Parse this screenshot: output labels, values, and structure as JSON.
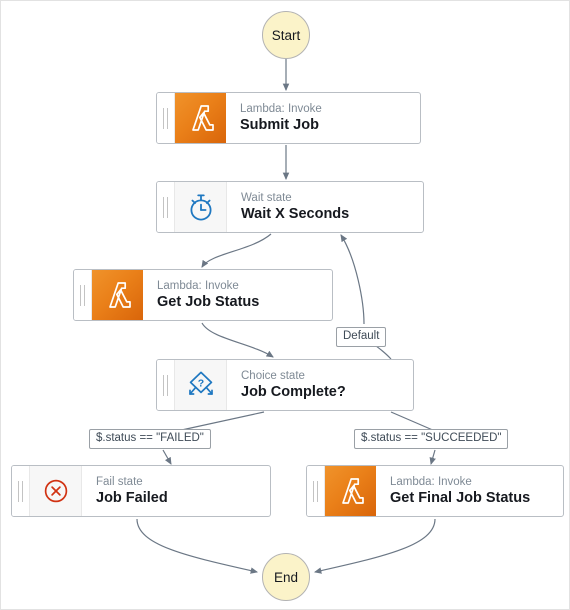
{
  "diagram": {
    "type": "aws-step-functions-state-machine",
    "start_node": {
      "label": "Start",
      "icon": "start-circle-icon"
    },
    "end_node": {
      "label": "End",
      "icon": "end-circle-icon"
    },
    "states": [
      {
        "id": "submit-job",
        "subtitle": "Lambda: Invoke",
        "title": "Submit Job",
        "icon": "aws-lambda-icon",
        "icon_kind": "lambda"
      },
      {
        "id": "wait-x-seconds",
        "subtitle": "Wait state",
        "title": "Wait X Seconds",
        "icon": "stopwatch-icon",
        "icon_kind": "wait"
      },
      {
        "id": "get-job-status",
        "subtitle": "Lambda: Invoke",
        "title": "Get Job Status",
        "icon": "aws-lambda-icon",
        "icon_kind": "lambda"
      },
      {
        "id": "job-complete",
        "subtitle": "Choice state",
        "title": "Job Complete?",
        "icon": "choice-diamond-icon",
        "icon_kind": "choice"
      },
      {
        "id": "job-failed",
        "subtitle": "Fail state",
        "title": "Job Failed",
        "icon": "fail-circle-x-icon",
        "icon_kind": "fail"
      },
      {
        "id": "get-final-job-status",
        "subtitle": "Lambda: Invoke",
        "title": "Get Final Job Status",
        "icon": "aws-lambda-icon",
        "icon_kind": "lambda"
      }
    ],
    "edge_labels": {
      "default": "Default",
      "failed": "$.status == \"FAILED\"",
      "succeeded": "$.status == \"SUCCEEDED\""
    },
    "colors": {
      "terminal_fill": "#fbf3c9",
      "terminal_border": "#b3b3b3",
      "lambda_orange": "#ea8019",
      "state_border": "#b9bec4",
      "edge_stroke": "#6b7785",
      "accent_blue": "#1f78c1",
      "fail_red": "#d13212",
      "subtitle_gray": "#7f8a95",
      "title_black": "#16191f"
    }
  }
}
